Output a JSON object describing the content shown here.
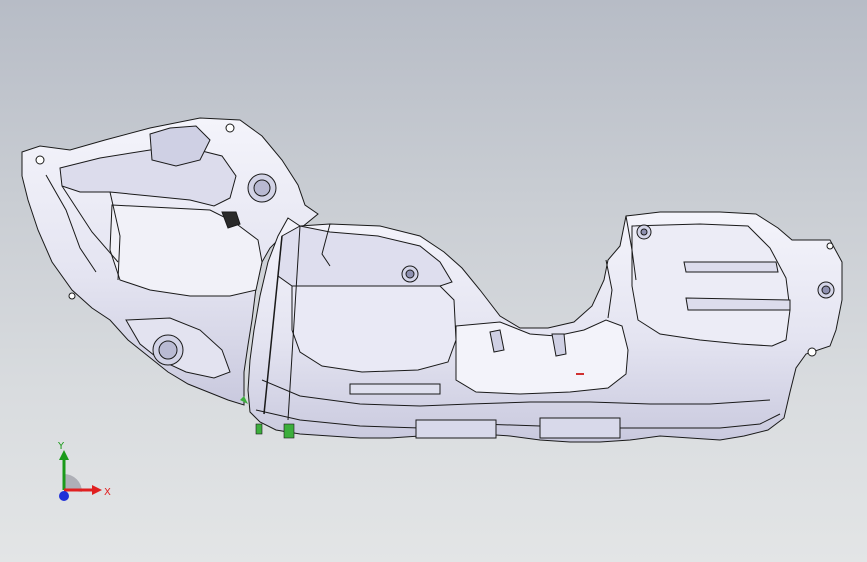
{
  "viewport": {
    "background_top": "#b7bcc6",
    "background_bottom": "#e3e5e6",
    "model_outline_color": "#1a1a1a",
    "model_face_color": "#e9e9f4",
    "model_shade_color": "#c7c8dc"
  },
  "triad": {
    "x_label": "X",
    "y_label": "Y",
    "x_color": "#e02020",
    "y_color": "#1a9a1a",
    "z_color": "#1f2fd8"
  }
}
